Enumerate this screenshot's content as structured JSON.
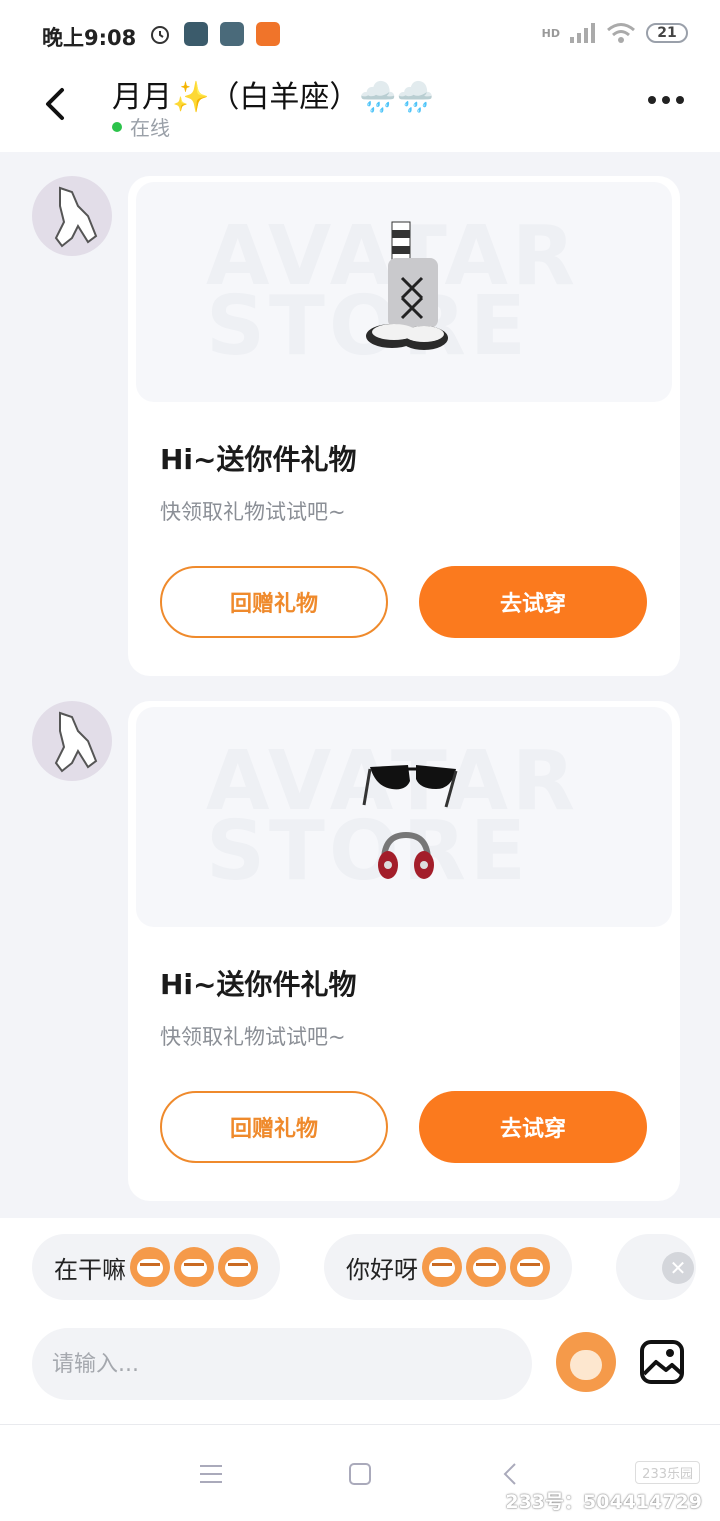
{
  "status_bar": {
    "time": "晚上9:08",
    "icons": [
      "alarm-icon",
      "compass-app-icon",
      "grid-app-icon",
      "233-app-icon"
    ],
    "network": "HD",
    "battery": "21"
  },
  "header": {
    "title": "月月✨（白羊座）🌧️🌧️",
    "status": "在线"
  },
  "messages": [
    {
      "card_title": "Hi~送你件礼物",
      "card_subtitle": "快领取礼物试试吧~",
      "image_watermark": "AVATAR STORE",
      "gift_items": [
        "socks-shoes-item"
      ],
      "secondary_button": "回赠礼物",
      "primary_button": "去试穿"
    },
    {
      "card_title": "Hi~送你件礼物",
      "card_subtitle": "快领取礼物试试吧~",
      "image_watermark": "AVATAR STORE",
      "gift_items": [
        "sunglasses-item",
        "headphones-item"
      ],
      "secondary_button": "回赠礼物",
      "primary_button": "去试穿"
    }
  ],
  "quick_replies": [
    {
      "label": "在干嘛"
    },
    {
      "label": "你好呀"
    }
  ],
  "composer": {
    "placeholder": "请输入..."
  },
  "footer": {
    "brand": "233乐园",
    "watermark": "233号：504414729"
  },
  "colors": {
    "accent": "#fb7a1e",
    "accent_outline": "#ef8a2c",
    "online": "#2cc34b"
  }
}
